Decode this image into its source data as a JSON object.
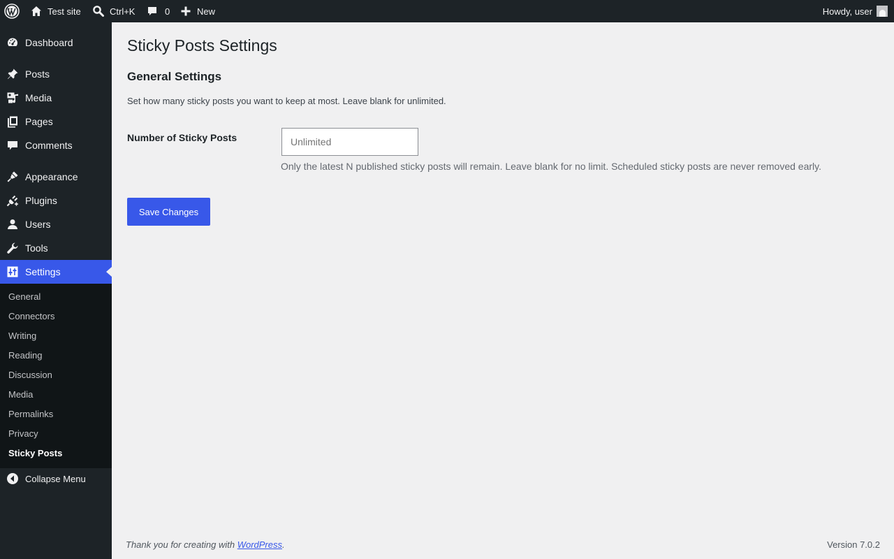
{
  "adminbar": {
    "site_name": "Test site",
    "search_shortcut": "Ctrl+K",
    "comments_count": "0",
    "new_label": "New",
    "howdy": "Howdy, user"
  },
  "sidebar": {
    "items": [
      {
        "label": "Dashboard",
        "icon": "dashboard-icon"
      },
      {
        "label": "Posts",
        "icon": "pin-icon"
      },
      {
        "label": "Media",
        "icon": "media-icon"
      },
      {
        "label": "Pages",
        "icon": "pages-icon"
      },
      {
        "label": "Comments",
        "icon": "comment-icon"
      },
      {
        "label": "Appearance",
        "icon": "brush-icon"
      },
      {
        "label": "Plugins",
        "icon": "plug-icon"
      },
      {
        "label": "Users",
        "icon": "user-icon"
      },
      {
        "label": "Tools",
        "icon": "wrench-icon"
      },
      {
        "label": "Settings",
        "icon": "sliders-icon"
      }
    ],
    "submenu": [
      "General",
      "Connectors",
      "Writing",
      "Reading",
      "Discussion",
      "Media",
      "Permalinks",
      "Privacy",
      "Sticky Posts"
    ],
    "collapse_label": "Collapse Menu"
  },
  "main": {
    "page_title": "Sticky Posts Settings",
    "section_title": "General Settings",
    "section_description": "Set how many sticky posts you want to keep at most. Leave blank for unlimited.",
    "field_label": "Number of Sticky Posts",
    "field_value": "",
    "field_placeholder": "Unlimited",
    "field_help": "Only the latest N published sticky posts will remain. Leave blank for no limit. Scheduled sticky posts are never removed early.",
    "save_label": "Save Changes"
  },
  "footer": {
    "thanks_prefix": "Thank you for creating with ",
    "thanks_link": "WordPress",
    "thanks_suffix": ".",
    "version": "Version 7.0.2"
  },
  "colors": {
    "accent": "#3858e9",
    "adminbar_bg": "#1d2327",
    "submenu_bg": "#101517",
    "page_bg": "#f0f0f1"
  }
}
